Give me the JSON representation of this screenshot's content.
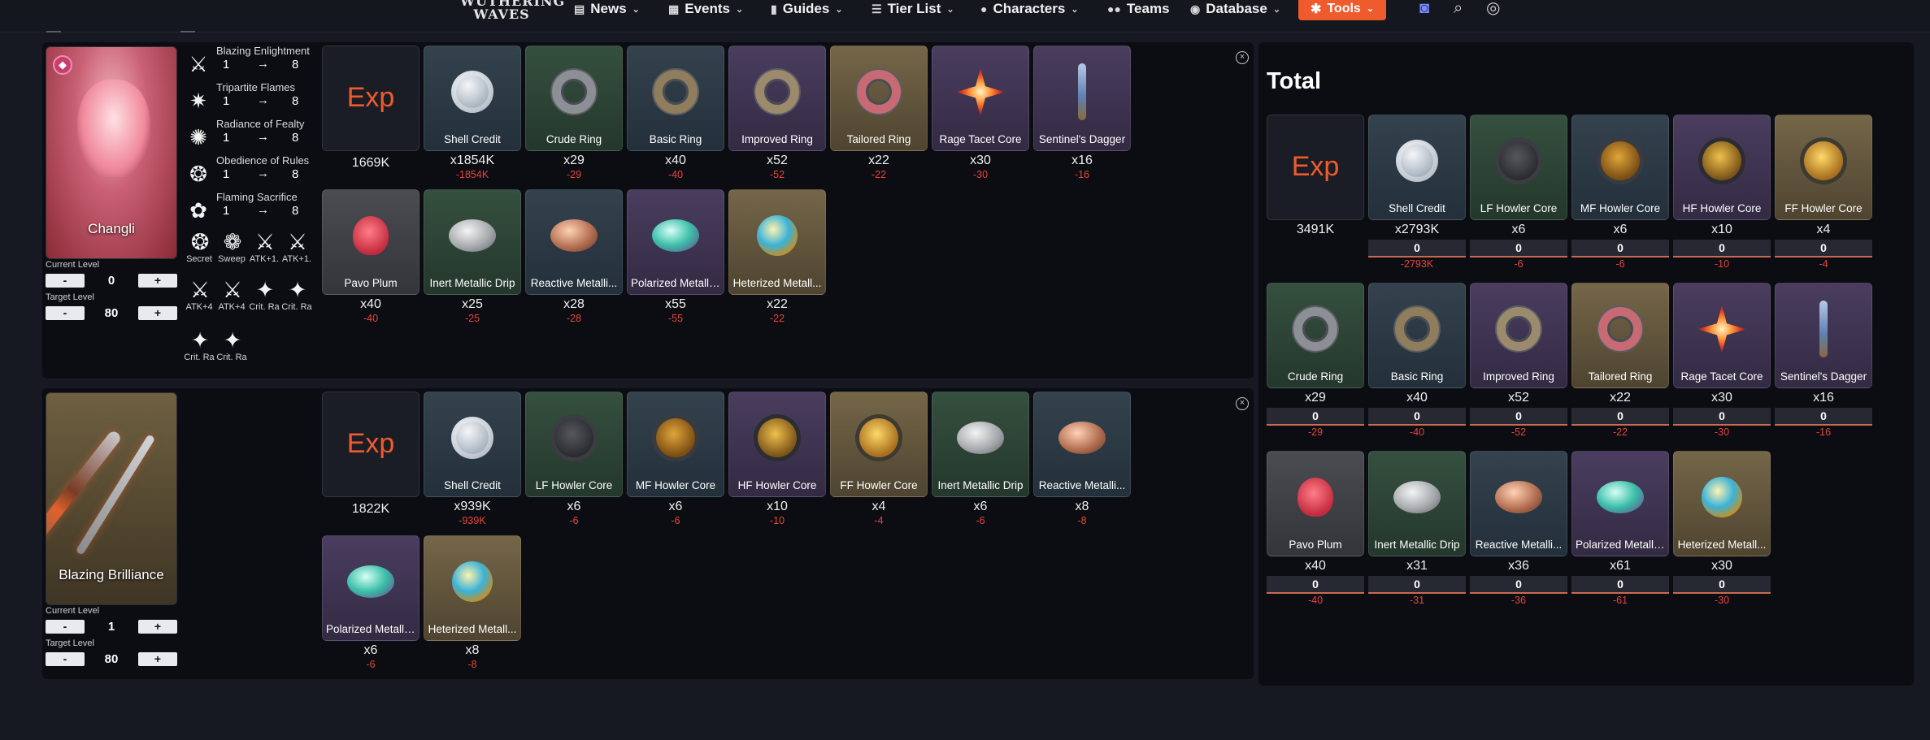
{
  "nav": {
    "logo_line1": "WUTHERING",
    "logo_line2": "WAVES",
    "items": [
      {
        "label": "News",
        "icon": "newspaper-icon"
      },
      {
        "label": "Events",
        "icon": "calendar-icon"
      },
      {
        "label": "Guides",
        "icon": "book-icon"
      },
      {
        "label": "Tier List",
        "icon": "list-icon"
      },
      {
        "label": "Characters",
        "icon": "user-icon"
      },
      {
        "label": "Teams",
        "icon": "users-icon"
      },
      {
        "label": "Database",
        "icon": "database-icon"
      }
    ],
    "tools_label": "Tools",
    "accent_color": "#ef5b2c"
  },
  "labels": {
    "current_level": "Current Level",
    "target_level": "Target Level",
    "minus": "-",
    "plus": "+",
    "arrow": "→",
    "total_title": "Total",
    "exp_label": "Exp"
  },
  "changli": {
    "name": "Changli",
    "current_level": "0",
    "target_level": "80",
    "skills": [
      {
        "name": "Blazing Enlightment",
        "from": "1",
        "to": "8"
      },
      {
        "name": "Tripartite Flames",
        "from": "1",
        "to": "8"
      },
      {
        "name": "Radiance of Fealty",
        "from": "1",
        "to": "8"
      },
      {
        "name": "Obedience of Rules",
        "from": "1",
        "to": "8"
      },
      {
        "name": "Flaming Sacrifice",
        "from": "1",
        "to": "8"
      }
    ],
    "minor_nodes": [
      {
        "label": "Secret"
      },
      {
        "label": "Sweep"
      },
      {
        "label": "ATK+1."
      },
      {
        "label": "ATK+1."
      },
      {
        "label": "ATK+4"
      },
      {
        "label": "ATK+4"
      },
      {
        "label": "Crit. Ra"
      },
      {
        "label": "Crit. Ra"
      },
      {
        "label": "Crit. Ra"
      },
      {
        "label": "Crit. Ra"
      }
    ],
    "exp": {
      "qty": "1669K"
    },
    "items": [
      {
        "name": "Shell Credit",
        "qty": "x1854K",
        "delta": "-1854K"
      },
      {
        "name": "Crude Ring",
        "qty": "x29",
        "delta": "-29"
      },
      {
        "name": "Basic Ring",
        "qty": "x40",
        "delta": "-40"
      },
      {
        "name": "Improved Ring",
        "qty": "x52",
        "delta": "-52"
      },
      {
        "name": "Tailored Ring",
        "qty": "x22",
        "delta": "-22"
      },
      {
        "name": "Rage Tacet Core",
        "qty": "x30",
        "delta": "-30"
      },
      {
        "name": "Sentinel's Dagger",
        "qty": "x16",
        "delta": "-16"
      },
      {
        "name": "Pavo Plum",
        "qty": "x40",
        "delta": "-40"
      },
      {
        "name": "Inert Metallic Drip",
        "qty": "x25",
        "delta": "-25"
      },
      {
        "name": "Reactive Metalli...",
        "qty": "x28",
        "delta": "-28"
      },
      {
        "name": "Polarized Metalli...",
        "qty": "x55",
        "delta": "-55"
      },
      {
        "name": "Heterized Metall...",
        "qty": "x22",
        "delta": "-22"
      }
    ]
  },
  "weapon": {
    "name": "Blazing Brilliance",
    "current_level": "1",
    "target_level": "80",
    "exp": {
      "qty": "1822K"
    },
    "items": [
      {
        "name": "Shell Credit",
        "qty": "x939K",
        "delta": "-939K"
      },
      {
        "name": "LF Howler Core",
        "qty": "x6",
        "delta": "-6"
      },
      {
        "name": "MF Howler Core",
        "qty": "x6",
        "delta": "-6"
      },
      {
        "name": "HF Howler Core",
        "qty": "x10",
        "delta": "-10"
      },
      {
        "name": "FF Howler Core",
        "qty": "x4",
        "delta": "-4"
      },
      {
        "name": "Inert Metallic Drip",
        "qty": "x6",
        "delta": "-6"
      },
      {
        "name": "Reactive Metalli...",
        "qty": "x8",
        "delta": "-8"
      },
      {
        "name": "Polarized Metalli...",
        "qty": "x6",
        "delta": "-6"
      },
      {
        "name": "Heterized Metall...",
        "qty": "x8",
        "delta": "-8"
      }
    ]
  },
  "total": {
    "exp": {
      "qty": "3491K"
    },
    "items": [
      {
        "name": "Shell Credit",
        "qty": "x2793K",
        "owned": "0",
        "delta": "-2793K"
      },
      {
        "name": "LF Howler Core",
        "qty": "x6",
        "owned": "0",
        "delta": "-6"
      },
      {
        "name": "MF Howler Core",
        "qty": "x6",
        "owned": "0",
        "delta": "-6"
      },
      {
        "name": "HF Howler Core",
        "qty": "x10",
        "owned": "0",
        "delta": "-10"
      },
      {
        "name": "FF Howler Core",
        "qty": "x4",
        "owned": "0",
        "delta": "-4"
      },
      {
        "name": "Crude Ring",
        "qty": "x29",
        "owned": "0",
        "delta": "-29"
      },
      {
        "name": "Basic Ring",
        "qty": "x40",
        "owned": "0",
        "delta": "-40"
      },
      {
        "name": "Improved Ring",
        "qty": "x52",
        "owned": "0",
        "delta": "-52"
      },
      {
        "name": "Tailored Ring",
        "qty": "x22",
        "owned": "0",
        "delta": "-22"
      },
      {
        "name": "Rage Tacet Core",
        "qty": "x30",
        "owned": "0",
        "delta": "-30"
      },
      {
        "name": "Sentinel's Dagger",
        "qty": "x16",
        "owned": "0",
        "delta": "-16"
      },
      {
        "name": "Pavo Plum",
        "qty": "x40",
        "owned": "0",
        "delta": "-40"
      },
      {
        "name": "Inert Metallic Drip",
        "qty": "x31",
        "owned": "0",
        "delta": "-31"
      },
      {
        "name": "Reactive Metalli...",
        "qty": "x36",
        "owned": "0",
        "delta": "-36"
      },
      {
        "name": "Polarized Metalli...",
        "qty": "x61",
        "owned": "0",
        "delta": "-61"
      },
      {
        "name": "Heterized Metall...",
        "qty": "x30",
        "owned": "0",
        "delta": "-30"
      }
    ]
  }
}
